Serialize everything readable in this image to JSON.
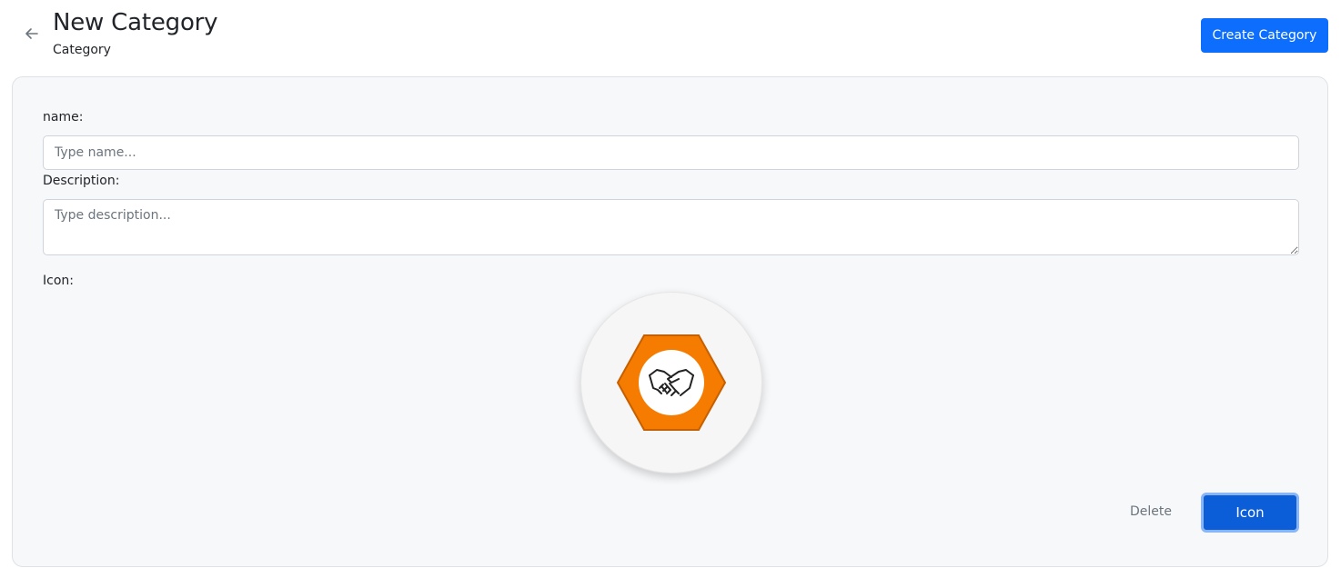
{
  "header": {
    "title": "New Category",
    "subtitle": "Category",
    "create_button_label": "Create Category"
  },
  "form": {
    "name_label": "name:",
    "name_placeholder": "Type name...",
    "name_value": "",
    "description_label": "Description:",
    "description_placeholder": "Type description...",
    "description_value": "",
    "icon_label": "Icon:",
    "icon_name": "handshake-icon",
    "icon_colors": {
      "hexagon": "#f57c00",
      "hexagon_border": "#c65f00",
      "inner_circle": "#ffffff"
    }
  },
  "actions": {
    "delete_label": "Delete",
    "icon_button_label": "Icon"
  },
  "colors": {
    "primary": "#0d6efd",
    "primary_active": "#0b5ed7",
    "card_background": "#f7f8fa"
  }
}
